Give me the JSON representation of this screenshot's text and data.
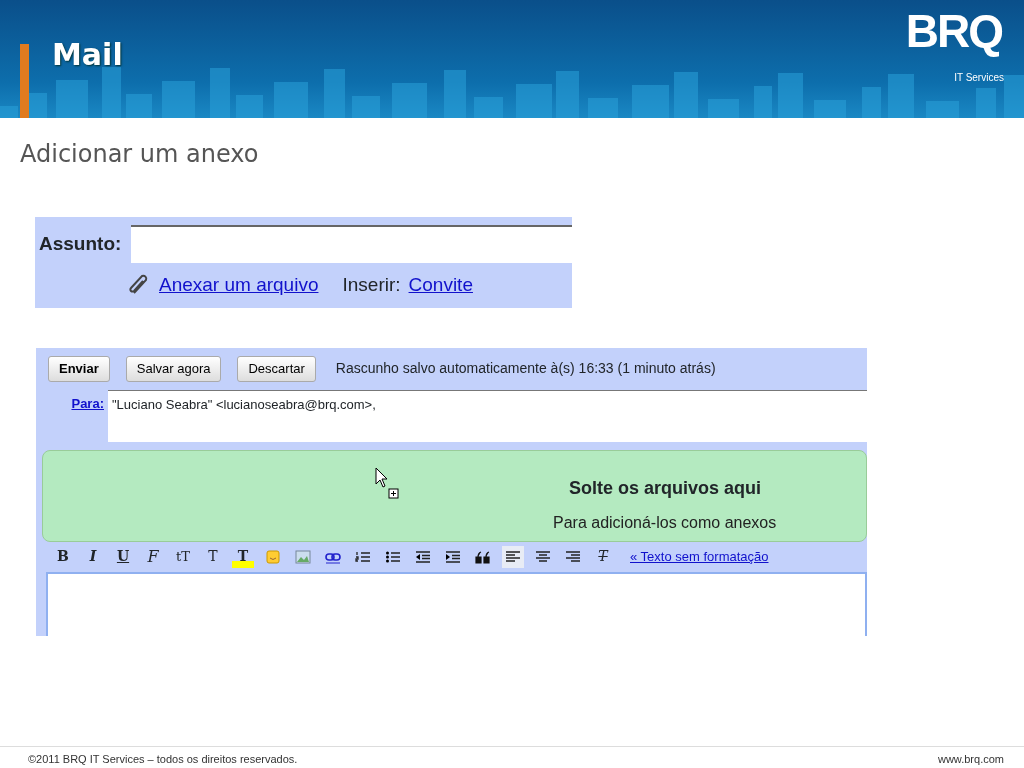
{
  "header": {
    "title": "Mail",
    "logo": "BRQ",
    "logo_subtitle": "IT Services"
  },
  "heading": "Adicionar um anexo",
  "subject_panel": {
    "label": "Assunto:",
    "attach_link": "Anexar um arquivo",
    "insert_label": "Inserir:",
    "insert_link": "Convite"
  },
  "compose_panel": {
    "buttons": [
      {
        "label": "Enviar",
        "bold": true
      },
      {
        "label": "Salvar agora",
        "bold": false
      },
      {
        "label": "Descartar",
        "bold": false
      }
    ],
    "status": "Rascunho salvo automaticamente à(s) 16:33 (1 minuto atrás)",
    "to_label": "Para:",
    "to_value": "\"Luciano Seabra\" <lucianoseabra@brq.com>,",
    "drop_zone": {
      "title": "Solte os arquivos aqui",
      "subtitle": "Para adicioná-los como anexos"
    },
    "toolbar": [
      {
        "kind": "bold",
        "label": "B",
        "selected": false
      },
      {
        "kind": "italic",
        "label": "I",
        "selected": false
      },
      {
        "kind": "underline",
        "label": "U",
        "selected": false
      },
      {
        "kind": "font",
        "label": "F",
        "selected": false
      },
      {
        "kind": "size",
        "label": "tT",
        "selected": false
      },
      {
        "kind": "text-color",
        "label": "T",
        "selected": false
      },
      {
        "kind": "highlight",
        "label": "T",
        "selected": false
      },
      {
        "kind": "emoji",
        "selected": false
      },
      {
        "kind": "image",
        "selected": false
      },
      {
        "kind": "link",
        "selected": false
      },
      {
        "kind": "numbered-list",
        "selected": false
      },
      {
        "kind": "bullet-list",
        "selected": false
      },
      {
        "kind": "outdent",
        "selected": false
      },
      {
        "kind": "indent",
        "selected": false
      },
      {
        "kind": "quote",
        "selected": false
      },
      {
        "kind": "align-left",
        "selected": true
      },
      {
        "kind": "align-center",
        "selected": false
      },
      {
        "kind": "align-right",
        "selected": false
      },
      {
        "kind": "clear-format",
        "label": "T",
        "selected": false
      }
    ],
    "plain_text_link": "« Texto sem formatação"
  },
  "footer": {
    "copyright": "©2011 BRQ IT Services – todos os direitos reservados.",
    "website": "www.brq.com"
  }
}
